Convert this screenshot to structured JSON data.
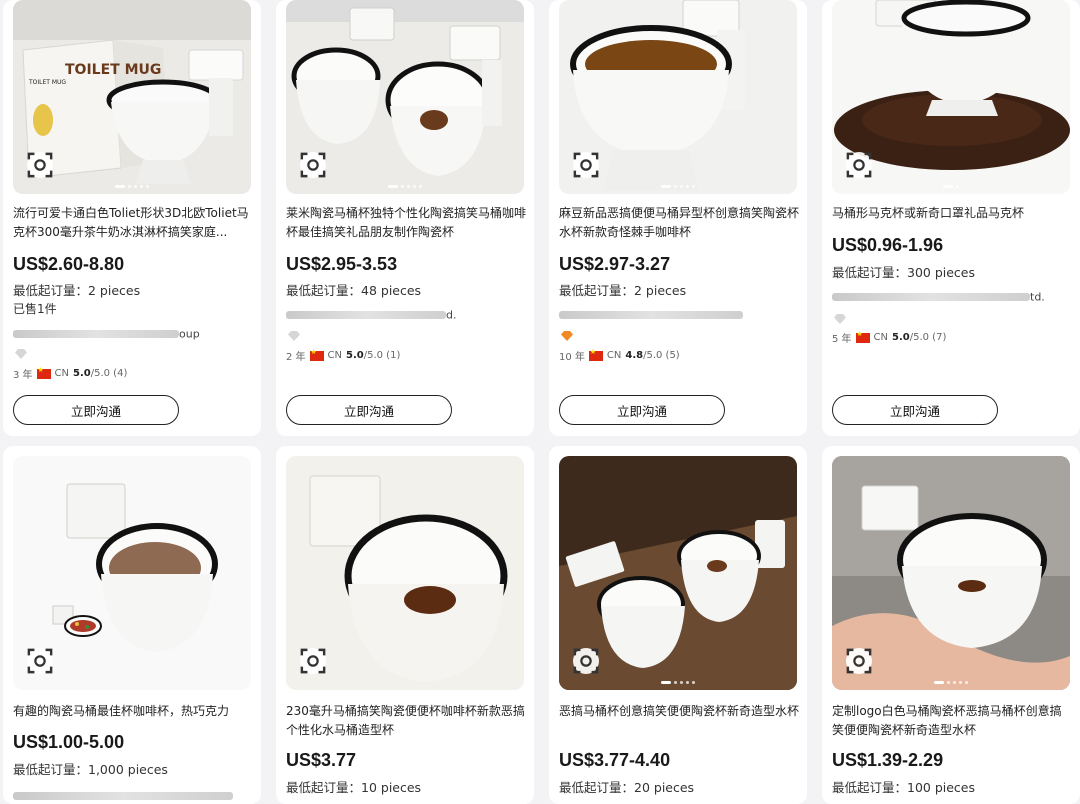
{
  "products": [
    {
      "title": "流行可爱卡通白色Toliet形状3D北欧Toliet马克杯300毫升茶牛奶冰淇淋杯搞笑家庭...",
      "price": "US$2.60-8.80",
      "moq": "最低起订量：2 pieces",
      "sold": "已售1件",
      "supplier_tail": "oup",
      "years": "3 年",
      "country": "CN",
      "rating": "5.0",
      "rating_suffix": "/5.0 (4)",
      "button": "立即沟通",
      "image": "toilet-mug-with-box",
      "box_text": "TOILET MUG",
      "box_text_small": "TOILET MUG"
    },
    {
      "title": "莱米陶瓷马桶杯独特个性化陶瓷搞笑马桶咖啡杯最佳搞笑礼品朋友制作陶瓷杯",
      "price": "US$2.95-3.53",
      "moq": "最低起订量：48 pieces",
      "supplier_tail": "d.",
      "years": "2 年",
      "country": "CN",
      "rating": "5.0",
      "rating_suffix": "/5.0 (1)",
      "button": "立即沟通",
      "image": "two-toilet-mugs"
    },
    {
      "title": "麻豆新品恶搞便便马桶异型杯创意搞笑陶瓷杯水杯新款奇怪棘手咖啡杯",
      "price": "US$2.97-3.27",
      "moq": "最低起订量：2 pieces",
      "supplier_tail": "",
      "years": "10 年",
      "country": "CN",
      "rating": "4.8",
      "rating_suffix": "/5.0 (5)",
      "button": "立即沟通",
      "image": "toilet-mug-coffee"
    },
    {
      "title": "马桶形马克杯或新奇口罩礼品马克杯",
      "price": "US$0.96-1.96",
      "moq": "最低起订量：300 pieces",
      "supplier_tail": "td.",
      "years": "5 年",
      "country": "CN",
      "rating": "5.0",
      "rating_suffix": "/5.0 (7)",
      "button": "立即沟通",
      "image": "toilet-mug-coffee-beans"
    },
    {
      "title": "有趣的陶瓷马桶最佳杯咖啡杯，热巧克力",
      "price": "US$1.00-5.00",
      "moq": "最低起订量：1,000 pieces",
      "image": "toilet-mug-hot-chocolate"
    },
    {
      "title": "230毫升马桶搞笑陶瓷便便杯咖啡杯新款恶搞个性化水马桶造型杯",
      "price": "US$3.77",
      "moq": "最低起订量：10 pieces",
      "image": "toilet-mug-closeup"
    },
    {
      "title": "恶搞马桶杯创意搞笑便便陶瓷杯新奇造型水杯",
      "price": "US$3.77-4.40",
      "moq": "最低起订量：20 pieces",
      "image": "two-toilet-mugs-on-table"
    },
    {
      "title": "定制logo白色马桶陶瓷杯恶搞马桶杯创意搞笑便便陶瓷杯新奇造型水杯",
      "price": "US$1.39-2.29",
      "moq": "最低起订量：100 pieces",
      "image": "toilet-mug-in-hand"
    }
  ],
  "icons": {
    "lens": "image-search-icon",
    "diamond": "diamond-icon",
    "flag": "china-flag-icon"
  },
  "colors": {
    "price": "#191919",
    "diamond_gold": "#f08a24",
    "flag_red": "#de2910"
  }
}
